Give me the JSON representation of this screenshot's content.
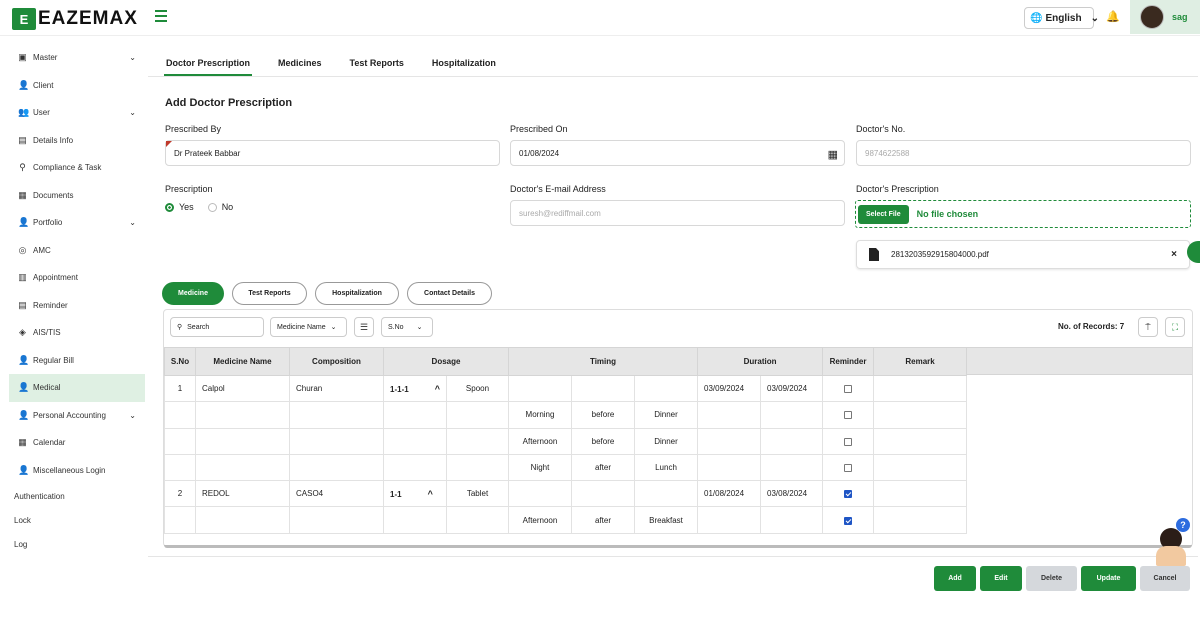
{
  "app": {
    "logo_mark": "E",
    "logo_text": "EAZEMAX"
  },
  "header": {
    "language": "English",
    "user_name": "sag"
  },
  "sidebar": {
    "items": [
      {
        "label": "Master",
        "icon": "cube-icon",
        "has_chevron": true
      },
      {
        "label": "Client",
        "icon": "user-icon",
        "has_chevron": false
      },
      {
        "label": "User",
        "icon": "user-group-icon",
        "has_chevron": true
      },
      {
        "label": "Details Info",
        "icon": "document-icon",
        "has_chevron": false
      },
      {
        "label": "Compliance & Task",
        "icon": "tasks-icon",
        "has_chevron": false
      },
      {
        "label": "Documents",
        "icon": "folder-icon",
        "has_chevron": false
      },
      {
        "label": "Portfolio",
        "icon": "briefcase-icon",
        "has_chevron": true
      },
      {
        "label": "AMC",
        "icon": "shield-icon",
        "has_chevron": false
      },
      {
        "label": "Appointment",
        "icon": "calendar-check-icon",
        "has_chevron": false
      },
      {
        "label": "Reminder",
        "icon": "clock-icon",
        "has_chevron": false
      },
      {
        "label": "AIS/TIS",
        "icon": "tag-icon",
        "has_chevron": false
      },
      {
        "label": "Regular Bill",
        "icon": "bill-icon",
        "has_chevron": false
      },
      {
        "label": "Medical",
        "icon": "medical-icon",
        "has_chevron": false,
        "active": true
      },
      {
        "label": "Personal Accounting",
        "icon": "wallet-icon",
        "has_chevron": true
      },
      {
        "label": "Calendar",
        "icon": "calendar-icon",
        "has_chevron": false
      },
      {
        "label": "Miscellaneous Login",
        "icon": "login-icon",
        "has_chevron": false
      }
    ],
    "plain_items": [
      "Authentication",
      "Lock",
      "Log"
    ]
  },
  "tabs": [
    {
      "label": "Doctor Prescription",
      "active": true
    },
    {
      "label": "Medicines"
    },
    {
      "label": "Test Reports"
    },
    {
      "label": "Hospitalization"
    }
  ],
  "form": {
    "title": "Add Doctor Prescription",
    "prescribed_by_label": "Prescribed By",
    "prescribed_by_value": "Dr Prateek Babbar",
    "prescribed_on_label": "Prescribed On",
    "prescribed_on_value": "01/08/2024",
    "doctor_no_label": "Doctor's No.",
    "doctor_no_value": "9874622588",
    "prescription_label": "Prescription",
    "prescription_yes": "Yes",
    "prescription_no": "No",
    "doctor_email_label": "Doctor's E-mail Address",
    "doctor_email_value": "suresh@rediffmail.com",
    "doctor_prescription_label": "Doctor's Prescription",
    "select_file_label": "Select File",
    "no_file_text": "No file chosen",
    "uploaded_file_name": "2813203592915804000.pdf"
  },
  "subtabs": [
    {
      "label": "Medicine",
      "active": true
    },
    {
      "label": "Test Reports"
    },
    {
      "label": "Hospitalization"
    },
    {
      "label": "Contact Details"
    }
  ],
  "toolbar": {
    "search_placeholder": "Search",
    "filter_field": "Medicine Name",
    "sort_field": "S.No",
    "records_label": "No. of Records: 7"
  },
  "table": {
    "headers": [
      "S.No",
      "Medicine Name",
      "Composition",
      "Dosage",
      "Timing",
      "Duration",
      "Reminder",
      "Remark"
    ],
    "rows": [
      {
        "sno": "1",
        "name": "Calpol",
        "comp": "Churan",
        "dose": "1-1-1",
        "unit": "Spoon",
        "t1": "",
        "t2": "",
        "t3": "",
        "from": "03/09/2024",
        "to": "03/09/2024",
        "reminder": false,
        "caret": true
      },
      {
        "sno": "",
        "name": "",
        "comp": "",
        "dose": "",
        "unit": "",
        "t1": "Morning",
        "t2": "before",
        "t3": "Dinner",
        "from": "",
        "to": "",
        "reminder": false,
        "caret": false
      },
      {
        "sno": "",
        "name": "",
        "comp": "",
        "dose": "",
        "unit": "",
        "t1": "Afternoon",
        "t2": "before",
        "t3": "Dinner",
        "from": "",
        "to": "",
        "reminder": false,
        "caret": false
      },
      {
        "sno": "",
        "name": "",
        "comp": "",
        "dose": "",
        "unit": "",
        "t1": "Night",
        "t2": "after",
        "t3": "Lunch",
        "from": "",
        "to": "",
        "reminder": false,
        "caret": false
      },
      {
        "sno": "2",
        "name": "REDOL",
        "comp": "CASO4",
        "dose": "1-1",
        "unit": "Tablet",
        "t1": "",
        "t2": "",
        "t3": "",
        "from": "01/08/2024",
        "to": "03/08/2024",
        "reminder": true,
        "caret": true
      },
      {
        "sno": "",
        "name": "",
        "comp": "",
        "dose": "",
        "unit": "",
        "t1": "Afternoon",
        "t2": "after",
        "t3": "Breakfast",
        "from": "",
        "to": "",
        "reminder": true,
        "caret": false
      }
    ]
  },
  "actions": {
    "add": "Add",
    "edit": "Edit",
    "delete": "Delete",
    "update": "Update",
    "cancel": "Cancel"
  },
  "colors": {
    "accent": "#1f8b3a",
    "checkbox_checked": "#1f55c5",
    "header_bg": "#e6e6e6"
  }
}
